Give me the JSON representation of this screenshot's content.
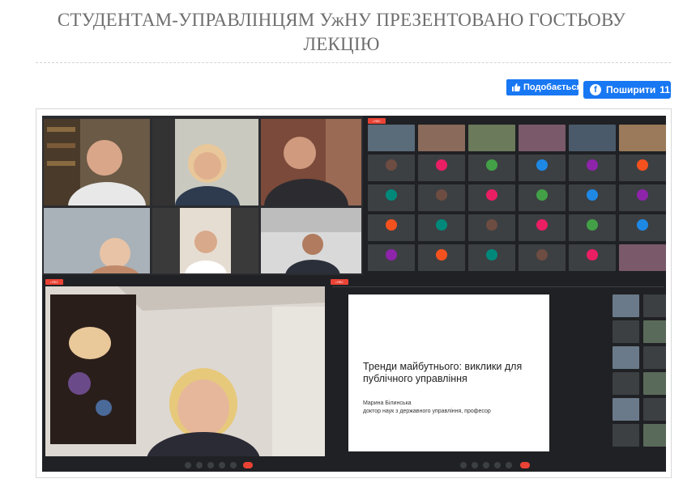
{
  "article": {
    "title_line1": "СТУДЕНТАМ-УПРАВЛІНЦЯМ УжНУ ПРЕЗЕНТОВАНО ГОСТЬОВУ",
    "title_line2": "ЛЕКЦІЮ"
  },
  "social": {
    "like_label": "Подобається",
    "share_label": "Поширити",
    "share_count": "11"
  },
  "colors": {
    "facebook_blue": "#1877f2",
    "meet_dark": "#202124",
    "record_red": "#ea4335"
  },
  "screenshot": {
    "slide": {
      "heading": "Тренди майбутнього: виклики для публічного управління",
      "author": "Марина Білинська",
      "author_title": "доктор наук з державного управління, професор"
    }
  }
}
